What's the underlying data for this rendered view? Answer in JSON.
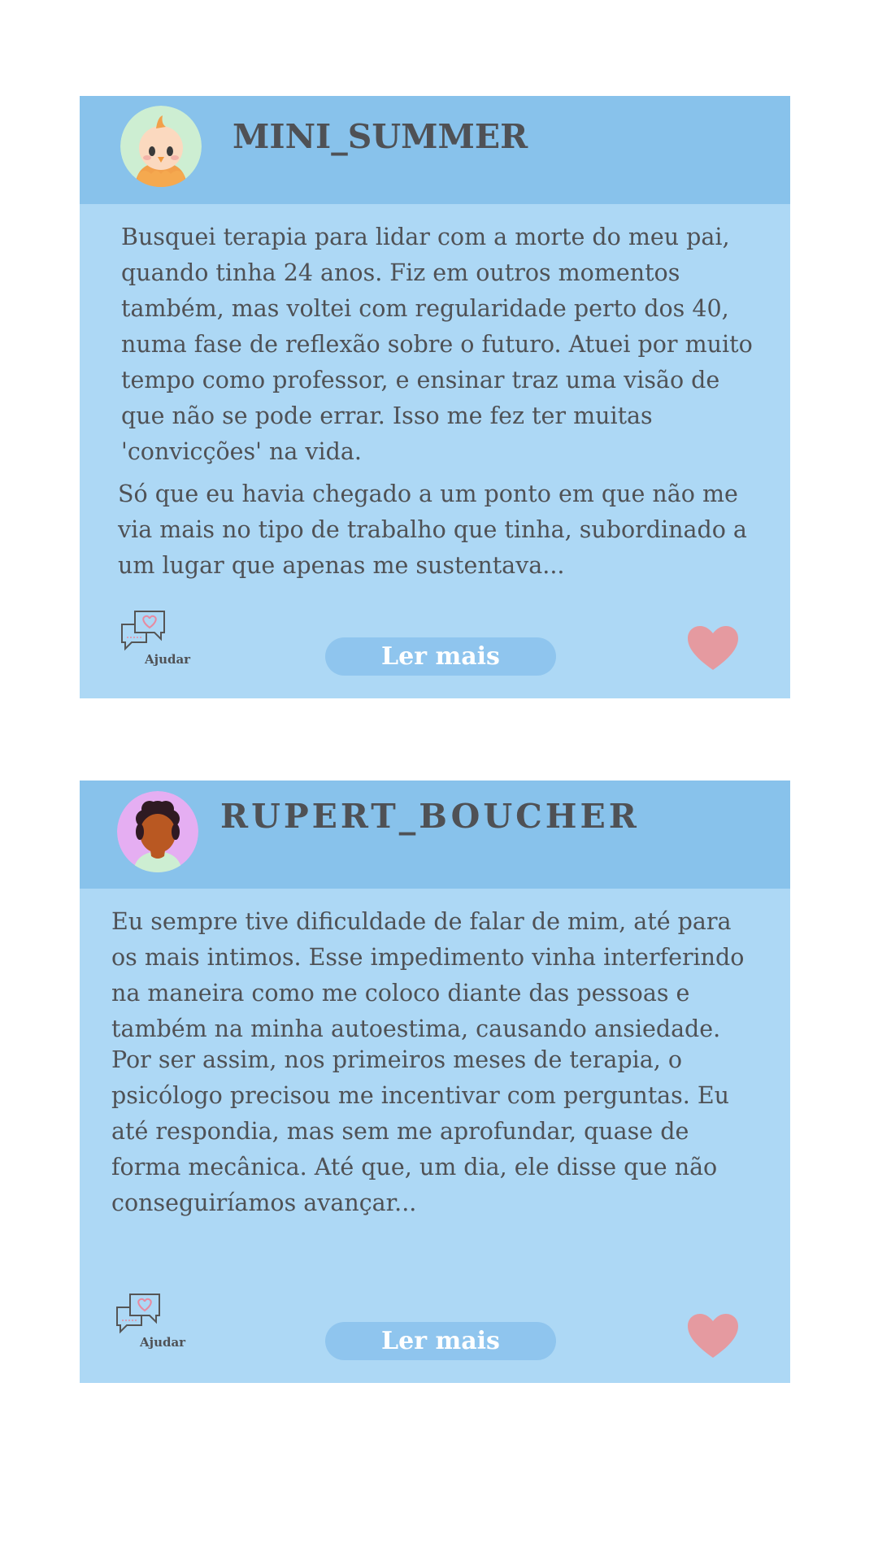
{
  "posts": [
    {
      "username": "MINI_SUMMER",
      "avatar_icon": "chick-avatar-icon",
      "paragraphs": [
        "Busquei terapia para lidar com a morte do meu pai, quando tinha 24 anos. Fiz em outros momentos também, mas voltei com regularidade perto dos 40, numa fase de reflexão sobre o futuro. Atuei por muito tempo como professor, e ensinar traz uma visão de que não se pode errar. Isso me fez ter muitas 'convicções' na vida.",
        "Só que eu havia chegado a um ponto em que não me via mais no tipo de trabalho que tinha, subordinado a um lugar que apenas me sustentava..."
      ],
      "help_label": "Ajudar",
      "help_icon": "chat-heart-icon",
      "read_more_label": "Ler mais",
      "like_icon": "heart-icon"
    },
    {
      "username": "RUPERT_BOUCHER",
      "avatar_icon": "person-avatar-icon",
      "paragraphs": [
        "Eu sempre tive dificuldade de falar de mim, até para os mais intimos. Esse impedimento vinha interferindo na maneira como me coloco diante das pessoas e também na minha autoestima, causando ansiedade.",
        "Por ser assim, nos primeiros meses de terapia, o psicólogo precisou me incentivar com perguntas. Eu até respondia, mas sem me aprofundar, quase de forma mecânica. Até que, um dia, ele disse que não conseguiríamos avançar..."
      ],
      "help_label": "Ajudar",
      "help_icon": "chat-heart-icon",
      "read_more_label": "Ler mais",
      "like_icon": "heart-icon"
    }
  ],
  "colors": {
    "card_body": "#add8f5",
    "card_header": "#88c2eb",
    "button": "#8fc5ee",
    "heart": "#e59aa0",
    "text": "#4f5155"
  }
}
